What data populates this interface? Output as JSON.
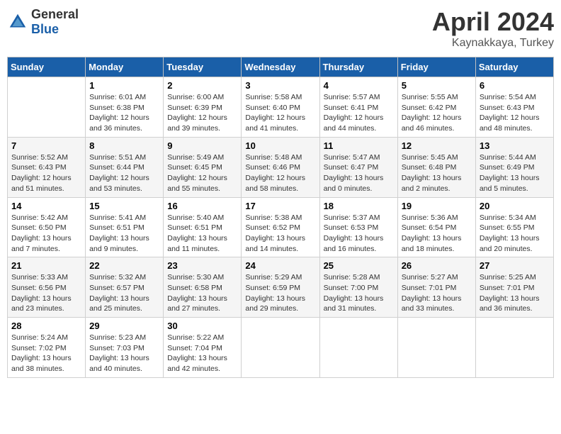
{
  "header": {
    "logo_general": "General",
    "logo_blue": "Blue",
    "month_title": "April 2024",
    "location": "Kaynakkaya, Turkey"
  },
  "weekdays": [
    "Sunday",
    "Monday",
    "Tuesday",
    "Wednesday",
    "Thursday",
    "Friday",
    "Saturday"
  ],
  "weeks": [
    [
      {
        "day": "",
        "info": ""
      },
      {
        "day": "1",
        "info": "Sunrise: 6:01 AM\nSunset: 6:38 PM\nDaylight: 12 hours\nand 36 minutes."
      },
      {
        "day": "2",
        "info": "Sunrise: 6:00 AM\nSunset: 6:39 PM\nDaylight: 12 hours\nand 39 minutes."
      },
      {
        "day": "3",
        "info": "Sunrise: 5:58 AM\nSunset: 6:40 PM\nDaylight: 12 hours\nand 41 minutes."
      },
      {
        "day": "4",
        "info": "Sunrise: 5:57 AM\nSunset: 6:41 PM\nDaylight: 12 hours\nand 44 minutes."
      },
      {
        "day": "5",
        "info": "Sunrise: 5:55 AM\nSunset: 6:42 PM\nDaylight: 12 hours\nand 46 minutes."
      },
      {
        "day": "6",
        "info": "Sunrise: 5:54 AM\nSunset: 6:43 PM\nDaylight: 12 hours\nand 48 minutes."
      }
    ],
    [
      {
        "day": "7",
        "info": "Sunrise: 5:52 AM\nSunset: 6:43 PM\nDaylight: 12 hours\nand 51 minutes."
      },
      {
        "day": "8",
        "info": "Sunrise: 5:51 AM\nSunset: 6:44 PM\nDaylight: 12 hours\nand 53 minutes."
      },
      {
        "day": "9",
        "info": "Sunrise: 5:49 AM\nSunset: 6:45 PM\nDaylight: 12 hours\nand 55 minutes."
      },
      {
        "day": "10",
        "info": "Sunrise: 5:48 AM\nSunset: 6:46 PM\nDaylight: 12 hours\nand 58 minutes."
      },
      {
        "day": "11",
        "info": "Sunrise: 5:47 AM\nSunset: 6:47 PM\nDaylight: 13 hours\nand 0 minutes."
      },
      {
        "day": "12",
        "info": "Sunrise: 5:45 AM\nSunset: 6:48 PM\nDaylight: 13 hours\nand 2 minutes."
      },
      {
        "day": "13",
        "info": "Sunrise: 5:44 AM\nSunset: 6:49 PM\nDaylight: 13 hours\nand 5 minutes."
      }
    ],
    [
      {
        "day": "14",
        "info": "Sunrise: 5:42 AM\nSunset: 6:50 PM\nDaylight: 13 hours\nand 7 minutes."
      },
      {
        "day": "15",
        "info": "Sunrise: 5:41 AM\nSunset: 6:51 PM\nDaylight: 13 hours\nand 9 minutes."
      },
      {
        "day": "16",
        "info": "Sunrise: 5:40 AM\nSunset: 6:51 PM\nDaylight: 13 hours\nand 11 minutes."
      },
      {
        "day": "17",
        "info": "Sunrise: 5:38 AM\nSunset: 6:52 PM\nDaylight: 13 hours\nand 14 minutes."
      },
      {
        "day": "18",
        "info": "Sunrise: 5:37 AM\nSunset: 6:53 PM\nDaylight: 13 hours\nand 16 minutes."
      },
      {
        "day": "19",
        "info": "Sunrise: 5:36 AM\nSunset: 6:54 PM\nDaylight: 13 hours\nand 18 minutes."
      },
      {
        "day": "20",
        "info": "Sunrise: 5:34 AM\nSunset: 6:55 PM\nDaylight: 13 hours\nand 20 minutes."
      }
    ],
    [
      {
        "day": "21",
        "info": "Sunrise: 5:33 AM\nSunset: 6:56 PM\nDaylight: 13 hours\nand 23 minutes."
      },
      {
        "day": "22",
        "info": "Sunrise: 5:32 AM\nSunset: 6:57 PM\nDaylight: 13 hours\nand 25 minutes."
      },
      {
        "day": "23",
        "info": "Sunrise: 5:30 AM\nSunset: 6:58 PM\nDaylight: 13 hours\nand 27 minutes."
      },
      {
        "day": "24",
        "info": "Sunrise: 5:29 AM\nSunset: 6:59 PM\nDaylight: 13 hours\nand 29 minutes."
      },
      {
        "day": "25",
        "info": "Sunrise: 5:28 AM\nSunset: 7:00 PM\nDaylight: 13 hours\nand 31 minutes."
      },
      {
        "day": "26",
        "info": "Sunrise: 5:27 AM\nSunset: 7:01 PM\nDaylight: 13 hours\nand 33 minutes."
      },
      {
        "day": "27",
        "info": "Sunrise: 5:25 AM\nSunset: 7:01 PM\nDaylight: 13 hours\nand 36 minutes."
      }
    ],
    [
      {
        "day": "28",
        "info": "Sunrise: 5:24 AM\nSunset: 7:02 PM\nDaylight: 13 hours\nand 38 minutes."
      },
      {
        "day": "29",
        "info": "Sunrise: 5:23 AM\nSunset: 7:03 PM\nDaylight: 13 hours\nand 40 minutes."
      },
      {
        "day": "30",
        "info": "Sunrise: 5:22 AM\nSunset: 7:04 PM\nDaylight: 13 hours\nand 42 minutes."
      },
      {
        "day": "",
        "info": ""
      },
      {
        "day": "",
        "info": ""
      },
      {
        "day": "",
        "info": ""
      },
      {
        "day": "",
        "info": ""
      }
    ]
  ]
}
